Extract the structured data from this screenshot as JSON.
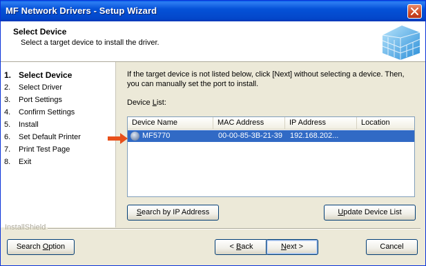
{
  "window": {
    "title": "MF Network Drivers - Setup Wizard"
  },
  "header": {
    "title": "Select Device",
    "subtitle": "Select a target device to install the driver."
  },
  "steps": [
    {
      "num": "1.",
      "label": "Select Device"
    },
    {
      "num": "2.",
      "label": "Select Driver"
    },
    {
      "num": "3.",
      "label": "Port Settings"
    },
    {
      "num": "4.",
      "label": "Confirm Settings"
    },
    {
      "num": "5.",
      "label": "Install"
    },
    {
      "num": "6.",
      "label": "Set Default Printer"
    },
    {
      "num": "7.",
      "label": "Print Test Page"
    },
    {
      "num": "8.",
      "label": "Exit"
    }
  ],
  "content": {
    "info": "If the target device is not listed below, click [Next] without selecting a device. Then, you can manually set the port to install.",
    "device_list_label": {
      "pre": "Device ",
      "key": "L",
      "post": "ist:"
    }
  },
  "list": {
    "columns": [
      "Device Name",
      "MAC Address",
      "IP Address",
      "Location"
    ],
    "rows": [
      {
        "name": "MF5770",
        "mac": "00-00-85-3B-21-39",
        "ip": "192.168.202...",
        "location": ""
      }
    ]
  },
  "buttons": {
    "search_ip": {
      "key": "S",
      "rest": "earch by IP Address"
    },
    "update": {
      "key": "U",
      "rest": "pdate Device List"
    },
    "search_option": {
      "pre": "Search ",
      "key": "O",
      "rest": "ption"
    },
    "back": {
      "pre": "< ",
      "key": "B",
      "rest": "ack"
    },
    "next": {
      "key": "N",
      "rest": "ext >"
    },
    "cancel": "Cancel"
  },
  "footer": {
    "brand": "InstallShield"
  },
  "colors": {
    "titlebar": "#0552d8",
    "selection": "#316ac5",
    "arrow": "#e8501a"
  }
}
